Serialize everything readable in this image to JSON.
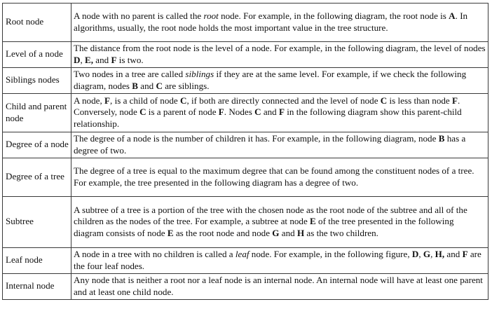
{
  "table": {
    "rows": [
      {
        "term": "Root node",
        "description": [
          {
            "t": "A node with no parent is called the "
          },
          {
            "t": "root",
            "i": true
          },
          {
            "t": " node. For example, in the following diagram, the root node is "
          },
          {
            "t": "A",
            "b": true
          },
          {
            "t": ". In algorithms, usually, the root node holds the most important value in the tree structure."
          }
        ]
      },
      {
        "term": "Level of a node",
        "description": [
          {
            "t": "The distance from the root node is the level of a node. For example, in the following diagram, the level of nodes "
          },
          {
            "t": "D",
            "b": true
          },
          {
            "t": ", "
          },
          {
            "t": "E,",
            "b": true
          },
          {
            "t": " and "
          },
          {
            "t": "F",
            "b": true
          },
          {
            "t": " is two."
          }
        ]
      },
      {
        "term": "Siblings nodes",
        "description": [
          {
            "t": "Two nodes in a tree are called "
          },
          {
            "t": "siblings",
            "i": true
          },
          {
            "t": " if they are at the same level. For example, if we check the following diagram, nodes "
          },
          {
            "t": "B",
            "b": true
          },
          {
            "t": " and "
          },
          {
            "t": "C",
            "b": true
          },
          {
            "t": " are siblings."
          }
        ]
      },
      {
        "term": "Child and parent node",
        "description": [
          {
            "t": "A node, "
          },
          {
            "t": "F",
            "b": true
          },
          {
            "t": ", is a child of node "
          },
          {
            "t": "C",
            "b": true
          },
          {
            "t": ", if both are directly connected and the level of node "
          },
          {
            "t": "C",
            "b": true
          },
          {
            "t": " is less than node "
          },
          {
            "t": "F",
            "b": true
          },
          {
            "t": ". Conversely, node "
          },
          {
            "t": "C",
            "b": true
          },
          {
            "t": " is a parent of node "
          },
          {
            "t": "F",
            "b": true
          },
          {
            "t": ". Nodes "
          },
          {
            "t": "C",
            "b": true
          },
          {
            "t": " and "
          },
          {
            "t": "F",
            "b": true
          },
          {
            "t": " in the following diagram show this parent-child relationship."
          }
        ]
      },
      {
        "term": "Degree of a node",
        "description": [
          {
            "t": "The degree of a node is the number of children it has. For example, in the following diagram, node "
          },
          {
            "t": "B",
            "b": true
          },
          {
            "t": " has a degree of two."
          }
        ]
      },
      {
        "term": "Degree of a tree",
        "description": [
          {
            "t": "The degree of a tree is equal to the maximum degree that can be found among the constituent nodes of a tree. For example, the tree presented in the following diagram has a degree of two."
          }
        ]
      },
      {
        "term": "Subtree",
        "description": [
          {
            "t": "A subtree of a tree is a portion of the tree with the chosen node as the root node of the subtree and all of the children as the nodes of the tree. For example, a subtree at node "
          },
          {
            "t": "E",
            "b": true
          },
          {
            "t": " of the tree presented in the following diagram consists of node "
          },
          {
            "t": "E",
            "b": true
          },
          {
            "t": " as the root node and node "
          },
          {
            "t": "G",
            "b": true
          },
          {
            "t": " and "
          },
          {
            "t": "H",
            "b": true
          },
          {
            "t": " as the two children."
          }
        ]
      },
      {
        "term": "Leaf node",
        "description": [
          {
            "t": "A node in a tree with no children is called a "
          },
          {
            "t": "leaf",
            "i": true
          },
          {
            "t": " node. For example, in the following figure, "
          },
          {
            "t": "D",
            "b": true
          },
          {
            "t": ", "
          },
          {
            "t": "G",
            "b": true
          },
          {
            "t": ", "
          },
          {
            "t": "H,",
            "b": true
          },
          {
            "t": " and "
          },
          {
            "t": "F",
            "b": true
          },
          {
            "t": " are the four leaf nodes."
          }
        ]
      },
      {
        "term": "Internal node",
        "description": [
          {
            "t": "Any node that is neither a root nor a leaf node is an internal node. An internal node will have at least one parent and at least one child node."
          }
        ]
      }
    ]
  }
}
